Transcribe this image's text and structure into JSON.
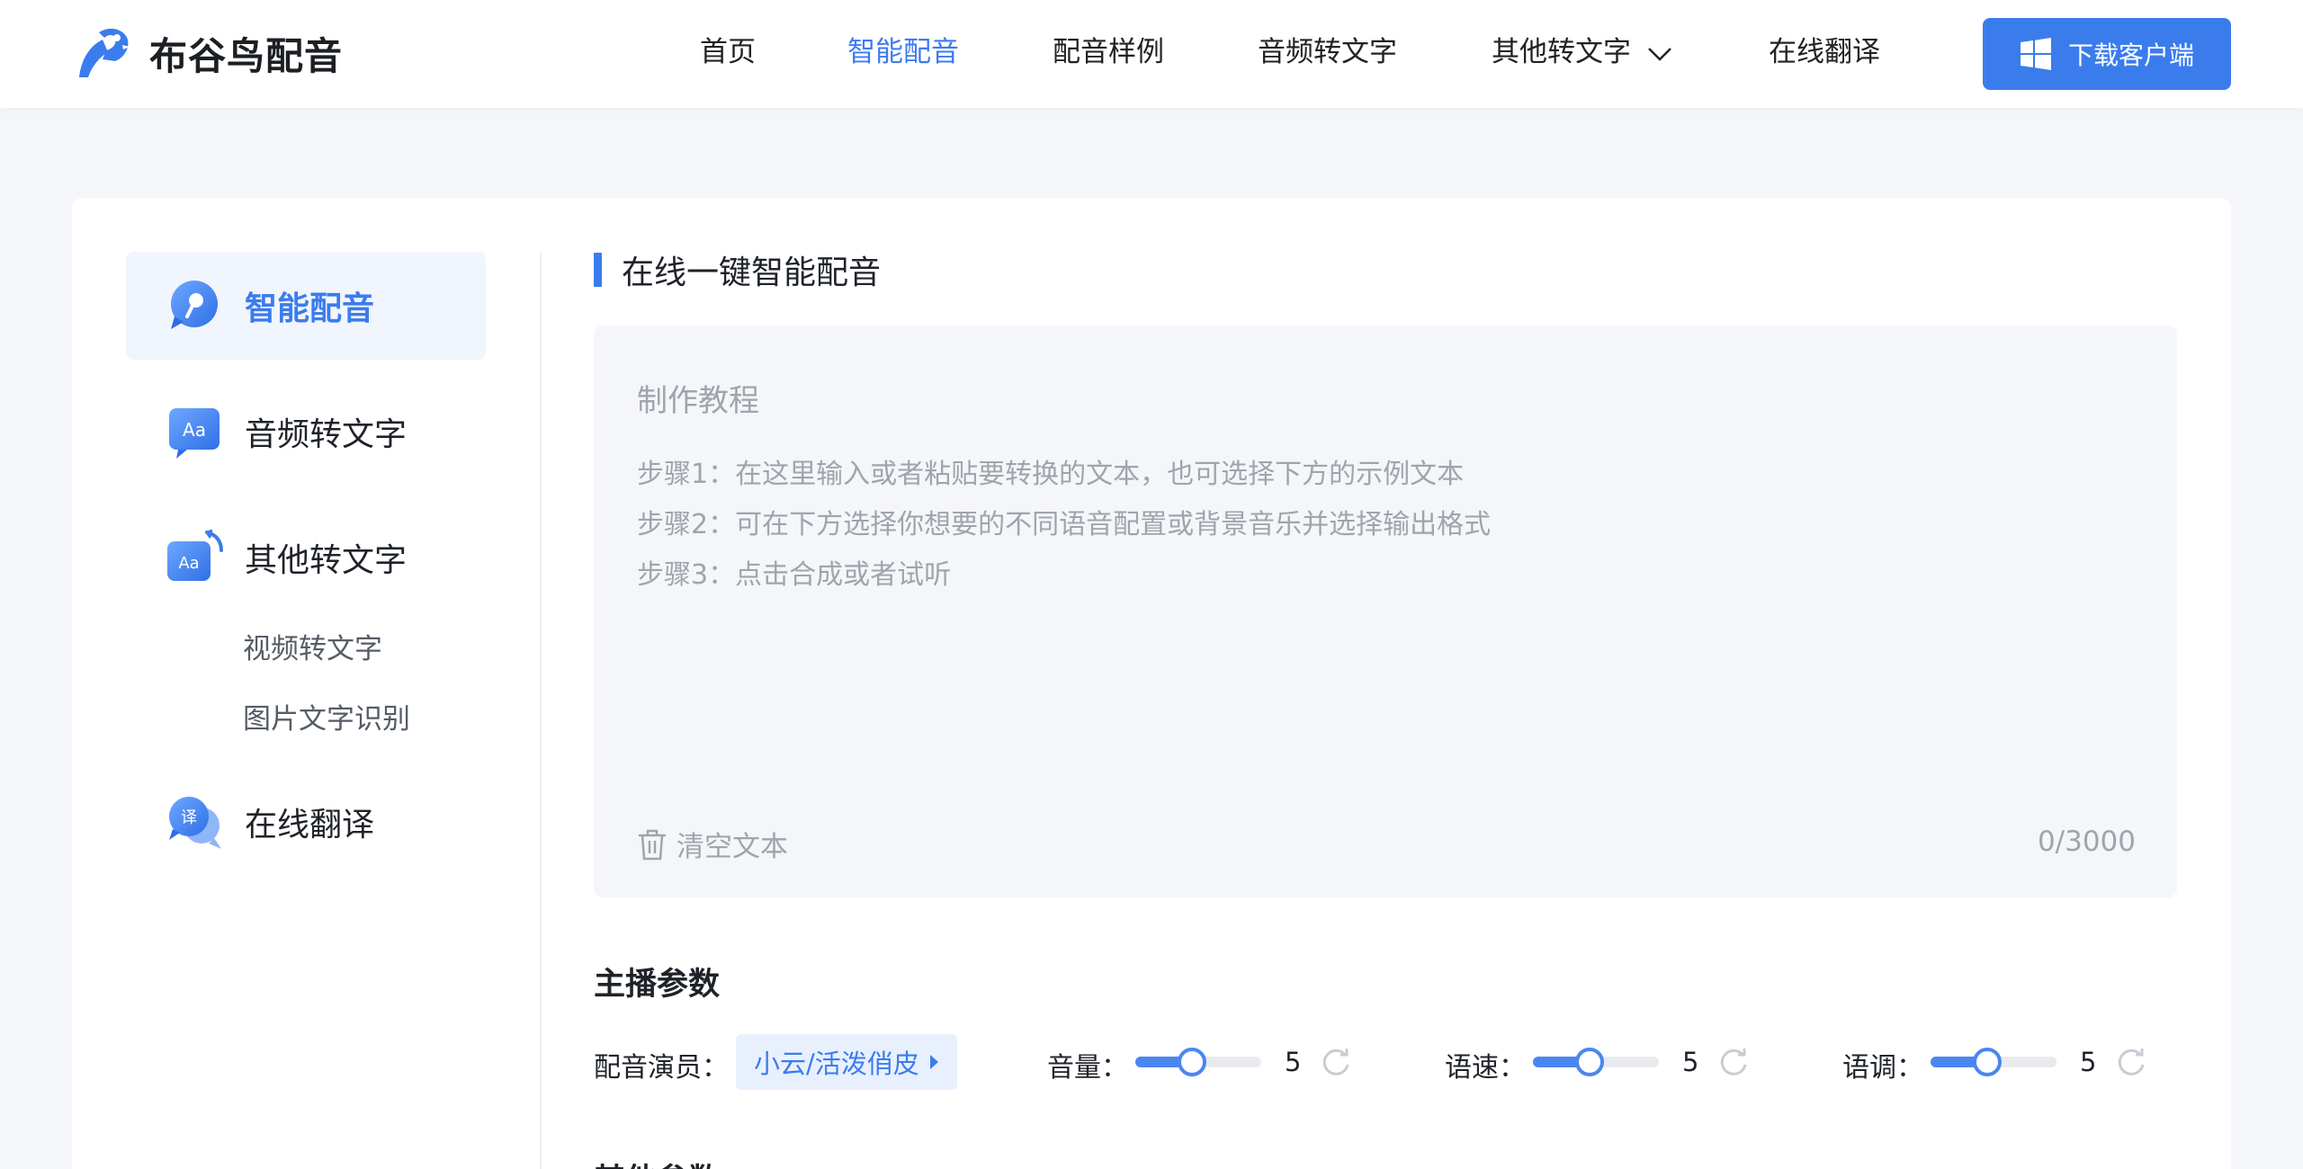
{
  "header": {
    "brand": "布谷鸟配音",
    "nav": [
      {
        "label": "首页"
      },
      {
        "label": "智能配音",
        "active": true
      },
      {
        "label": "配音样例"
      },
      {
        "label": "音频转文字"
      },
      {
        "label": "其他转文字",
        "has_dropdown": true
      },
      {
        "label": "在线翻译"
      }
    ],
    "download_label": "下载客户端"
  },
  "sidebar": {
    "items": [
      {
        "label": "智能配音",
        "icon": "mic-bubble-icon",
        "active": true
      },
      {
        "label": "音频转文字",
        "icon": "aa-text-icon"
      },
      {
        "label": "其他转文字",
        "icon": "aa-convert-icon",
        "children": [
          "视频转文字",
          "图片文字识别"
        ]
      },
      {
        "label": "在线翻译",
        "icon": "translate-bubble-icon"
      }
    ]
  },
  "editor": {
    "section_title": "在线一键智能配音",
    "placeholder_title": "制作教程",
    "steps": [
      "步骤1：在这里输入或者粘贴要转换的文本，也可选择下方的示例文本",
      "步骤2：可在下方选择你想要的不同语音配置或背景音乐并选择输出格式",
      "步骤3：点击合成或者试听"
    ],
    "clear_label": "清空文本",
    "counter": "0/3000"
  },
  "params": {
    "title": "主播参数",
    "voice_label": "配音演员：",
    "voice_value": "小云/活泼俏皮",
    "volume": {
      "label": "音量：",
      "value": "5",
      "level": 0.45
    },
    "speed": {
      "label": "语速：",
      "value": "5",
      "level": 0.45
    },
    "pitch": {
      "label": "语调：",
      "value": "5",
      "level": 0.45
    }
  },
  "next_section_title": "其他参数",
  "colors": {
    "accent": "#3b7ced",
    "page_bg": "#f4f6fa",
    "editor_bg": "#f5f6fa"
  }
}
